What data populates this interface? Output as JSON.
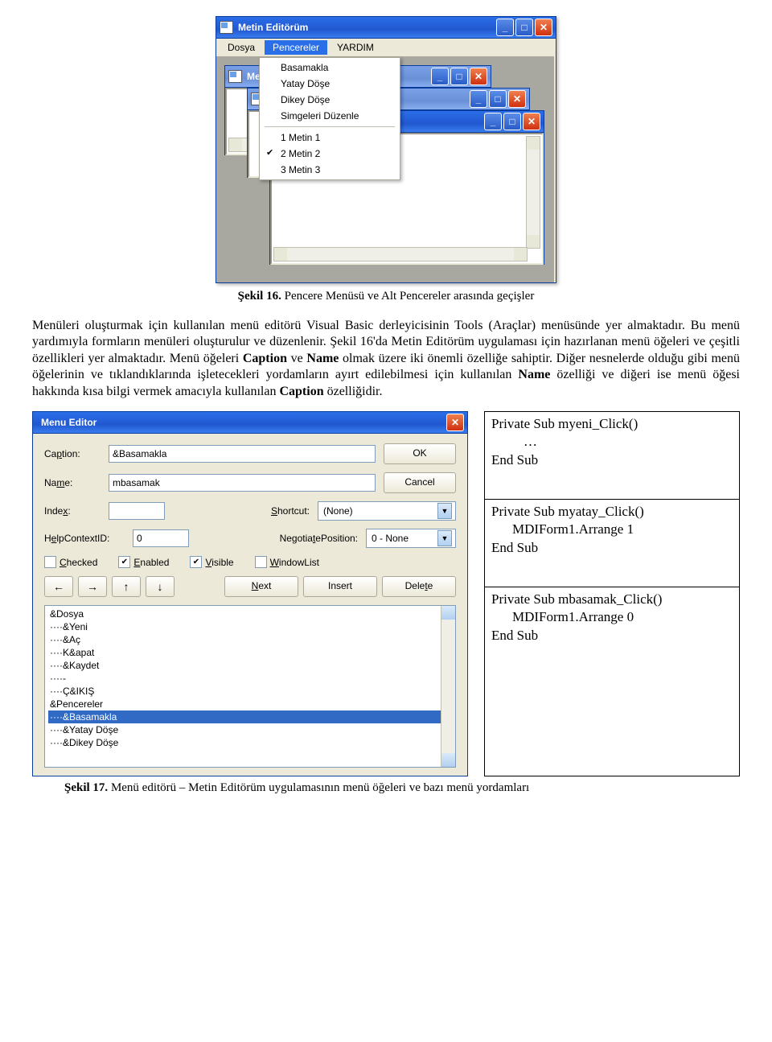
{
  "fig1": {
    "main_title": "Metin Editörüm",
    "menubar": {
      "dosya": "Dosya",
      "pencereler": "Pencereler",
      "yardim": "YARDIM"
    },
    "dropdown": {
      "basamakla": "Basamakla",
      "yatay": "Yatay Döşe",
      "dikey": "Dikey Döşe",
      "simgeler": "Simgeleri Düzenle",
      "w1": "1 Metin 1",
      "w2": "2 Metin 2",
      "w3": "3 Metin 3"
    },
    "child1_title": "Me",
    "caption_label": "Şekil 16.",
    "caption_text": " Pencere Menüsü ve Alt Pencereler arasında geçişler"
  },
  "para1": "Menüleri oluşturmak için kullanılan menü editörü Visual Basic derleyicisinin Tools (Araçlar) menüsünde yer almaktadır. Bu menü yardımıyla formların menüleri oluşturulur ve düzenlenir. Şekil 16'da Metin Editörüm uygulaması için hazırlanan menü öğeleri ve çeşitli özellikleri yer almaktadır. Menü öğeleri ",
  "para_b1": "Caption",
  "para_mid1": " ve ",
  "para_b2": "Name",
  "para_mid2": " olmak üzere iki önemli özelliğe sahiptir. Diğer nesnelerde olduğu gibi menü öğelerinin ve tıklandıklarında işletecekleri yordamların ayırt edilebilmesi için kullanılan ",
  "para_b3": "Name",
  "para_mid3": " özelliği ve diğeri ise menü öğesi hakkında kısa bilgi vermek amacıyla kullanılan ",
  "para_b4": "Caption",
  "para_end": " özelliğidir.",
  "me": {
    "title": "Menu Editor",
    "caption_label": "Caption:",
    "caption_value": "&Basamakla",
    "name_label": "Name:",
    "name_value": "mbasamak",
    "index_label": "Index:",
    "index_value": "",
    "shortcut_label": "Shortcut:",
    "shortcut_value": "(None)",
    "help_label": "HelpContextID:",
    "help_value": "0",
    "negpos_label": "NegotiatePosition:",
    "negpos_value": "0 - None",
    "ok": "OK",
    "cancel": "Cancel",
    "checked": "Checked",
    "enabled": "Enabled",
    "visible": "Visible",
    "windowlist": "WindowList",
    "next": "Next",
    "insert": "Insert",
    "delete": "Delete",
    "list": [
      "&Dosya",
      "····&Yeni",
      "····&Aç",
      "····K&apat",
      "····&Kaydet",
      "····-",
      "····Ç&IKIŞ",
      "&Pencereler",
      "····&Basamakla",
      "····&Yatay Döşe",
      "····&Dikey Döşe"
    ],
    "selected_index": 8
  },
  "code": {
    "c1_l1": "Private Sub myeni_Click()",
    "c1_l2": "…",
    "c1_l3": "End Sub",
    "c2_l1": "Private Sub myatay_Click()",
    "c2_l2": "MDIForm1.Arrange 1",
    "c2_l3": "End Sub",
    "c3_l1": "Private Sub mbasamak_Click()",
    "c3_l2": "MDIForm1.Arrange 0",
    "c3_l3": "End Sub"
  },
  "fig2": {
    "label": "Şekil 17.",
    "text": " Menü editörü – Metin Editörüm uygulamasının menü öğeleri ve bazı menü yordamları"
  }
}
